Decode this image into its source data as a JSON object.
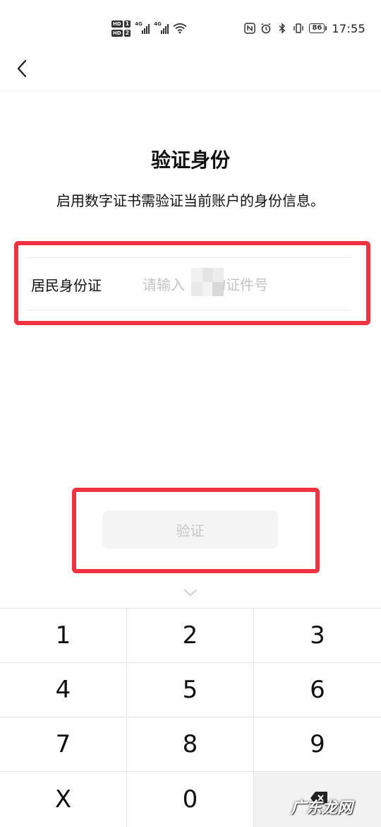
{
  "status_bar": {
    "sim1_label": "HD",
    "sim1_num": "1",
    "sim2_label": "HD",
    "sim2_num": "2",
    "network1": "4G",
    "network2": "4G",
    "battery_level": "86",
    "time": "17:55",
    "icons": [
      "nfc-icon",
      "alarm-icon",
      "bluetooth-icon",
      "vibrate-icon",
      "wifi-icon"
    ]
  },
  "header": {
    "back_icon": "chevron-left-icon"
  },
  "page": {
    "title": "验证身份",
    "subtitle": "启用数字证书需验证当前账户的身份信息。"
  },
  "form": {
    "id_label": "居民身份证",
    "id_value": "",
    "id_placeholder": "请输入      的证件号"
  },
  "actions": {
    "verify_label": "验证",
    "verify_enabled": false
  },
  "keyboard": {
    "collapse_icon": "chevron-down-icon",
    "keys": [
      "1",
      "2",
      "3",
      "4",
      "5",
      "6",
      "7",
      "8",
      "9",
      "X",
      "0"
    ],
    "delete_icon": "backspace-icon"
  },
  "watermark": "广东龙网",
  "colors": {
    "highlight": "#ef3340",
    "placeholder": "#c4c4c4",
    "button_bg": "#f4f4f4",
    "button_text": "#c6c6c6"
  }
}
